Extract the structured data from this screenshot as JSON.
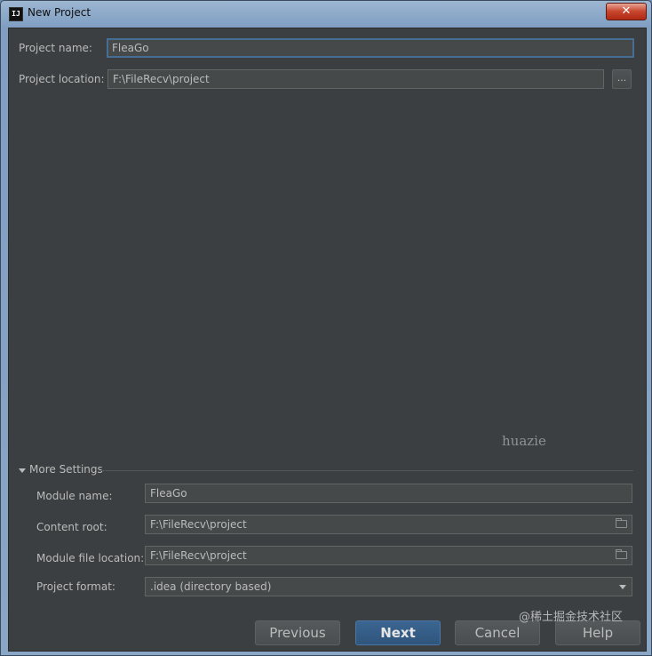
{
  "window": {
    "title": "New Project",
    "app_icon_text": "IJ",
    "close_label": "✕",
    "colors": {
      "client_bg": "#3c3f41",
      "field_bg": "#45494a",
      "primary_button": "#365880"
    }
  },
  "form": {
    "project_name_label": "Project name:",
    "project_name_value": "FleaGo",
    "project_location_label": "Project location:",
    "project_location_value": "F:\\FileRecv\\project",
    "browse_label": "..."
  },
  "watermark_text": "huazie",
  "more_settings": {
    "title": "More Settings",
    "module_name_label": "Module name:",
    "module_name_value": "FleaGo",
    "content_root_label": "Content root:",
    "content_root_value": "F:\\FileRecv\\project",
    "module_file_location_label": "Module file location:",
    "module_file_location_value": "F:\\FileRecv\\project",
    "project_format_label": "Project format:",
    "project_format_value": ".idea (directory based)"
  },
  "buttons": {
    "previous": "Previous",
    "next": "Next",
    "cancel": "Cancel",
    "help": "Help"
  },
  "corner_text": "@稀土掘金技术社区"
}
